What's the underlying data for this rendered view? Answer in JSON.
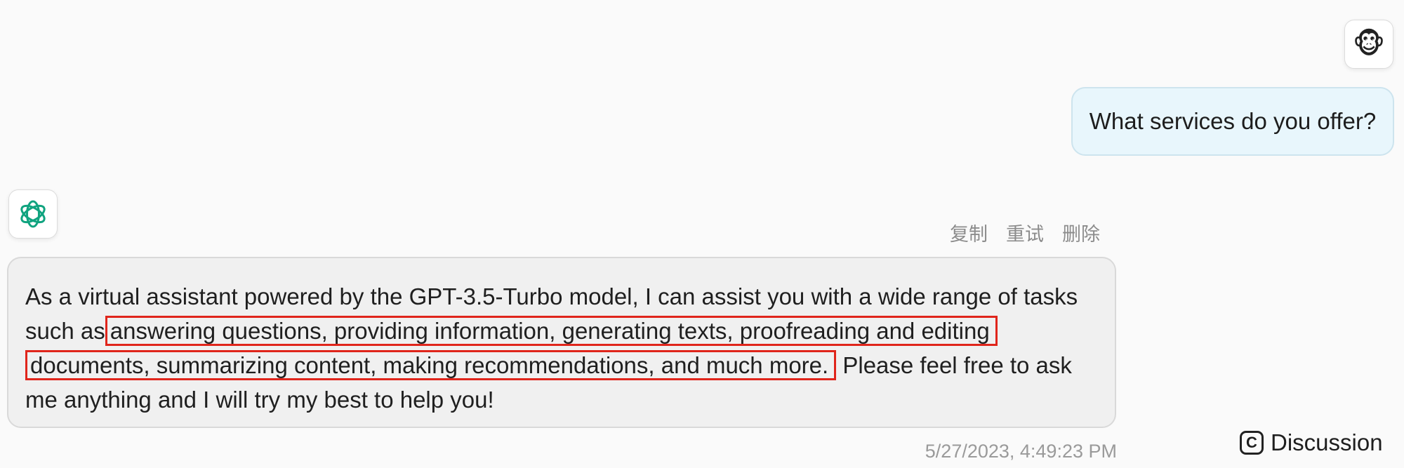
{
  "user_message": {
    "avatar_icon": "monkey-face-icon",
    "avatar_emoji": "🐵",
    "text": "What services do you offer?"
  },
  "bot_message": {
    "avatar_icon": "openai-logo-icon",
    "actions": {
      "copy": "复制",
      "retry": "重试",
      "delete": "删除"
    },
    "line1": "As a virtual assistant powered by the GPT-3.5-Turbo model, I can assist you with a wide range of tasks",
    "line2_prefix": "such as",
    "line2_highlight": "answering questions, providing information, generating texts, proofreading and editing",
    "line3_highlight": "documents, summarizing content, making recommendations, and much more.",
    "line3_suffix": "Please feel free to ask",
    "line4": "me anything and I will try my best to help you!",
    "timestamp": "5/27/2023, 4:49:23 PM",
    "highlight_color": "#e0251b"
  },
  "footer": {
    "discussion_label": "Discussion",
    "discussion_icon": "c-box-icon",
    "discussion_icon_glyph": "C"
  },
  "colors": {
    "user_bubble_bg": "#e8f6fc",
    "bot_bubble_bg": "#f0f0f0",
    "openai_logo": "#10a37f"
  }
}
